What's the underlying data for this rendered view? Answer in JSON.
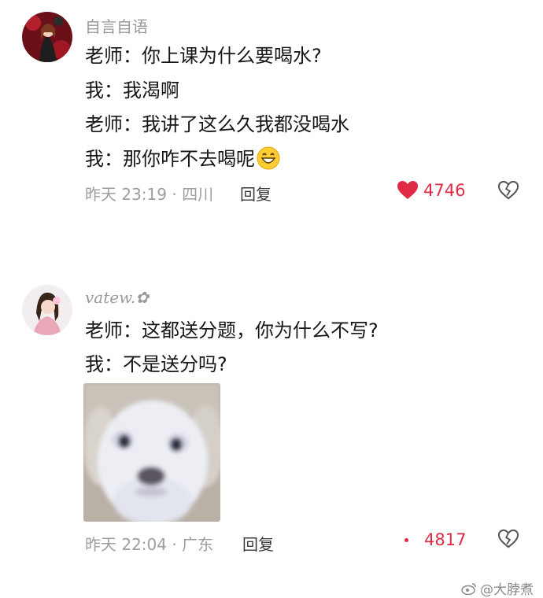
{
  "comments": [
    {
      "username": "自言自语",
      "lines": [
        "老师：你上课为什么要喝水?",
        "我：我渴啊",
        "老师：我讲了这么久我都没喝水",
        "我：那你咋不去喝呢"
      ],
      "meta": "昨天 23:19 · 四川",
      "reply_label": "回复",
      "likes": "4746",
      "liked": true
    },
    {
      "username": "vatew.✿",
      "lines": [
        "老师：这都送分题，你为什么不写?",
        "我：不是送分吗?"
      ],
      "meta": "昨天 22:04 · 广东",
      "reply_label": "回复",
      "likes": "4817",
      "liked": false
    }
  ],
  "watermark": "@大脖煮",
  "colors": {
    "like": "#e02b45",
    "meta": "#9e9e9e",
    "text": "#161616"
  }
}
